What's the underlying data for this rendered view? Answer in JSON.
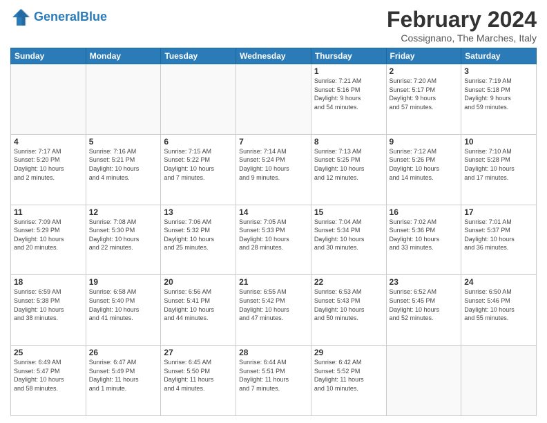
{
  "header": {
    "logo_line1": "General",
    "logo_line2": "Blue",
    "title": "February 2024",
    "subtitle": "Cossignano, The Marches, Italy"
  },
  "weekdays": [
    "Sunday",
    "Monday",
    "Tuesday",
    "Wednesday",
    "Thursday",
    "Friday",
    "Saturday"
  ],
  "weeks": [
    [
      {
        "day": "",
        "info": ""
      },
      {
        "day": "",
        "info": ""
      },
      {
        "day": "",
        "info": ""
      },
      {
        "day": "",
        "info": ""
      },
      {
        "day": "1",
        "info": "Sunrise: 7:21 AM\nSunset: 5:16 PM\nDaylight: 9 hours\nand 54 minutes."
      },
      {
        "day": "2",
        "info": "Sunrise: 7:20 AM\nSunset: 5:17 PM\nDaylight: 9 hours\nand 57 minutes."
      },
      {
        "day": "3",
        "info": "Sunrise: 7:19 AM\nSunset: 5:18 PM\nDaylight: 9 hours\nand 59 minutes."
      }
    ],
    [
      {
        "day": "4",
        "info": "Sunrise: 7:17 AM\nSunset: 5:20 PM\nDaylight: 10 hours\nand 2 minutes."
      },
      {
        "day": "5",
        "info": "Sunrise: 7:16 AM\nSunset: 5:21 PM\nDaylight: 10 hours\nand 4 minutes."
      },
      {
        "day": "6",
        "info": "Sunrise: 7:15 AM\nSunset: 5:22 PM\nDaylight: 10 hours\nand 7 minutes."
      },
      {
        "day": "7",
        "info": "Sunrise: 7:14 AM\nSunset: 5:24 PM\nDaylight: 10 hours\nand 9 minutes."
      },
      {
        "day": "8",
        "info": "Sunrise: 7:13 AM\nSunset: 5:25 PM\nDaylight: 10 hours\nand 12 minutes."
      },
      {
        "day": "9",
        "info": "Sunrise: 7:12 AM\nSunset: 5:26 PM\nDaylight: 10 hours\nand 14 minutes."
      },
      {
        "day": "10",
        "info": "Sunrise: 7:10 AM\nSunset: 5:28 PM\nDaylight: 10 hours\nand 17 minutes."
      }
    ],
    [
      {
        "day": "11",
        "info": "Sunrise: 7:09 AM\nSunset: 5:29 PM\nDaylight: 10 hours\nand 20 minutes."
      },
      {
        "day": "12",
        "info": "Sunrise: 7:08 AM\nSunset: 5:30 PM\nDaylight: 10 hours\nand 22 minutes."
      },
      {
        "day": "13",
        "info": "Sunrise: 7:06 AM\nSunset: 5:32 PM\nDaylight: 10 hours\nand 25 minutes."
      },
      {
        "day": "14",
        "info": "Sunrise: 7:05 AM\nSunset: 5:33 PM\nDaylight: 10 hours\nand 28 minutes."
      },
      {
        "day": "15",
        "info": "Sunrise: 7:04 AM\nSunset: 5:34 PM\nDaylight: 10 hours\nand 30 minutes."
      },
      {
        "day": "16",
        "info": "Sunrise: 7:02 AM\nSunset: 5:36 PM\nDaylight: 10 hours\nand 33 minutes."
      },
      {
        "day": "17",
        "info": "Sunrise: 7:01 AM\nSunset: 5:37 PM\nDaylight: 10 hours\nand 36 minutes."
      }
    ],
    [
      {
        "day": "18",
        "info": "Sunrise: 6:59 AM\nSunset: 5:38 PM\nDaylight: 10 hours\nand 38 minutes."
      },
      {
        "day": "19",
        "info": "Sunrise: 6:58 AM\nSunset: 5:40 PM\nDaylight: 10 hours\nand 41 minutes."
      },
      {
        "day": "20",
        "info": "Sunrise: 6:56 AM\nSunset: 5:41 PM\nDaylight: 10 hours\nand 44 minutes."
      },
      {
        "day": "21",
        "info": "Sunrise: 6:55 AM\nSunset: 5:42 PM\nDaylight: 10 hours\nand 47 minutes."
      },
      {
        "day": "22",
        "info": "Sunrise: 6:53 AM\nSunset: 5:43 PM\nDaylight: 10 hours\nand 50 minutes."
      },
      {
        "day": "23",
        "info": "Sunrise: 6:52 AM\nSunset: 5:45 PM\nDaylight: 10 hours\nand 52 minutes."
      },
      {
        "day": "24",
        "info": "Sunrise: 6:50 AM\nSunset: 5:46 PM\nDaylight: 10 hours\nand 55 minutes."
      }
    ],
    [
      {
        "day": "25",
        "info": "Sunrise: 6:49 AM\nSunset: 5:47 PM\nDaylight: 10 hours\nand 58 minutes."
      },
      {
        "day": "26",
        "info": "Sunrise: 6:47 AM\nSunset: 5:49 PM\nDaylight: 11 hours\nand 1 minute."
      },
      {
        "day": "27",
        "info": "Sunrise: 6:45 AM\nSunset: 5:50 PM\nDaylight: 11 hours\nand 4 minutes."
      },
      {
        "day": "28",
        "info": "Sunrise: 6:44 AM\nSunset: 5:51 PM\nDaylight: 11 hours\nand 7 minutes."
      },
      {
        "day": "29",
        "info": "Sunrise: 6:42 AM\nSunset: 5:52 PM\nDaylight: 11 hours\nand 10 minutes."
      },
      {
        "day": "",
        "info": ""
      },
      {
        "day": "",
        "info": ""
      }
    ]
  ]
}
